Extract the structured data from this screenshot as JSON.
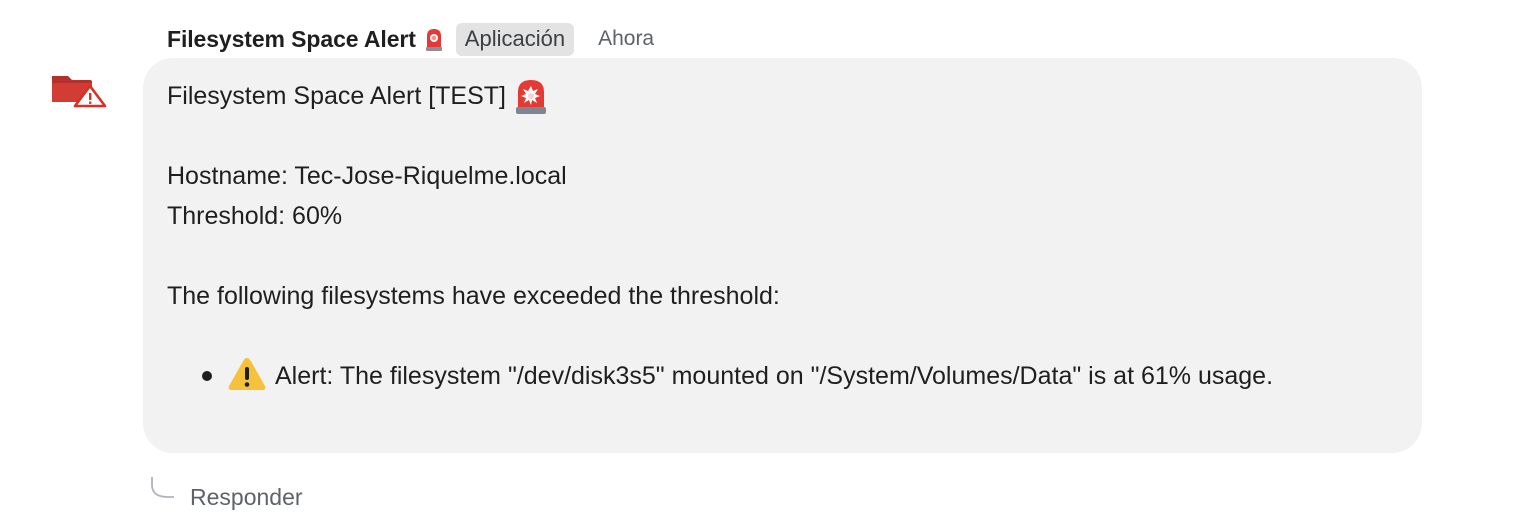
{
  "header": {
    "sender": "Filesystem Space Alert",
    "badge": "Aplicación",
    "time": "Ahora"
  },
  "message": {
    "title": "Filesystem Space Alert [TEST]",
    "hostname_line": "Hostname: Tec-Jose-Riquelme.local",
    "threshold_line": "Threshold: 60%",
    "intro_line": "The following filesystems have exceeded the threshold:",
    "alerts": [
      "Alert: The filesystem \"/dev/disk3s5\" mounted on \"/System/Volumes/Data\" is at 61% usage."
    ]
  },
  "actions": {
    "reply_label": "Responder"
  },
  "icons": {
    "avatar": "folder-alert-icon",
    "siren": "police-light-icon",
    "warning": "warning-icon",
    "reply": "reply-thread-icon"
  },
  "colors": {
    "bubble": "#f2f2f2",
    "badge_bg": "#e3e3e3",
    "folder_red": "#c5312b",
    "warning_yellow": "#f6c23c"
  }
}
